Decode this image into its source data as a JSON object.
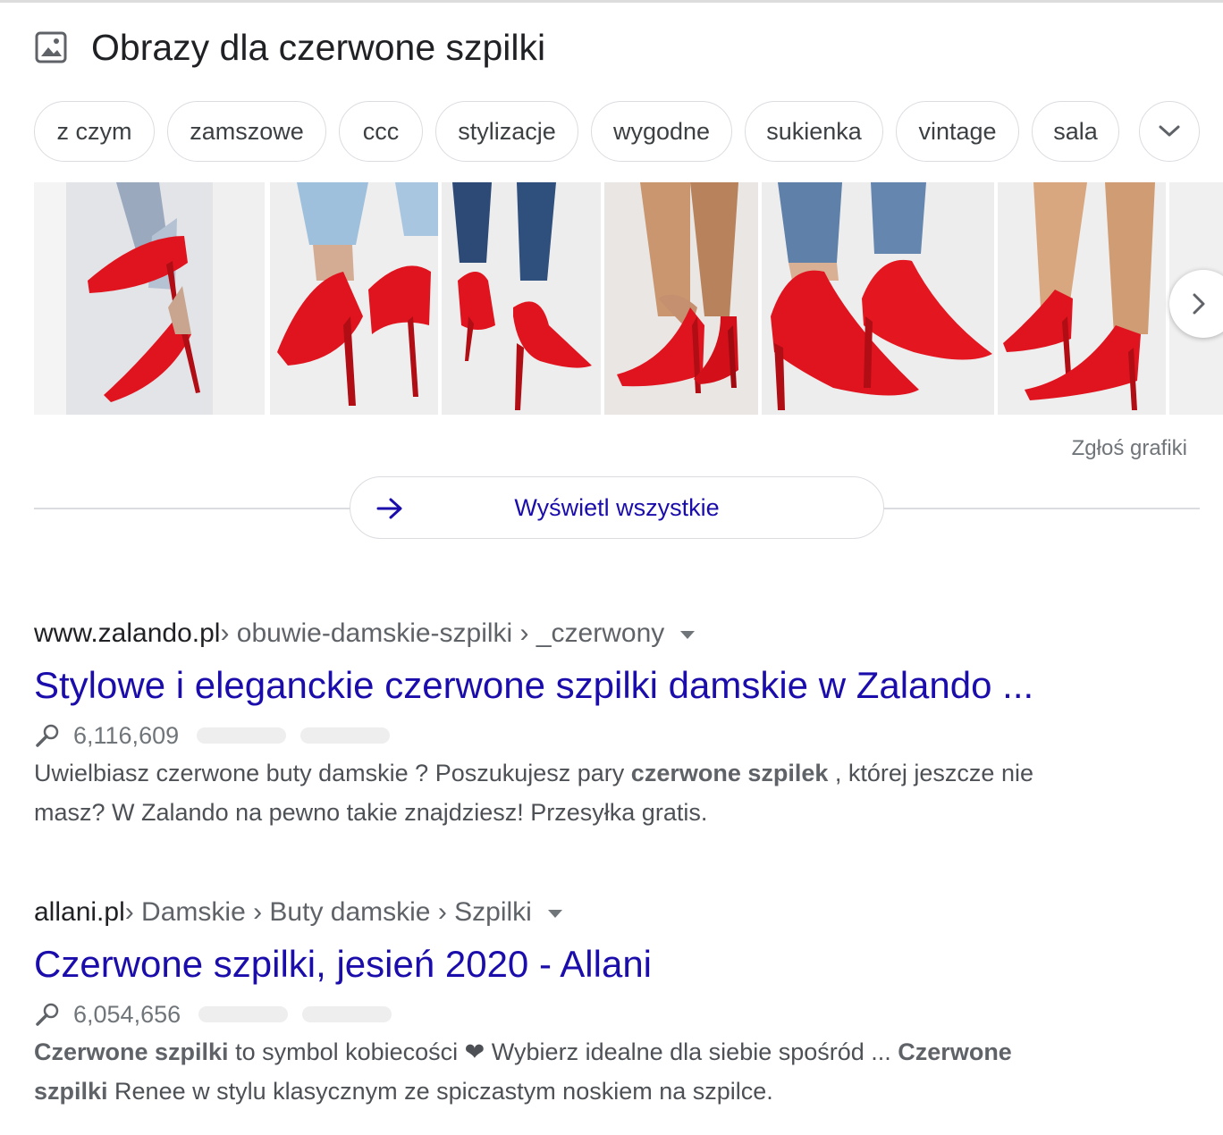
{
  "images_section": {
    "title": "Obrazy dla czerwone szpilki",
    "icon": "image-icon",
    "chips": [
      "z czym",
      "zamszowe",
      "ccc",
      "stylizacje",
      "wygodne",
      "sukienka",
      "vintage",
      "sala"
    ],
    "report_label": "Zgłoś grafiki",
    "view_all_label": "Wyświetl wszystkie"
  },
  "results": [
    {
      "domain": "www.zalando.pl",
      "path": " › obuwie-damskie-szpilki › _czerwony",
      "title": "Stylowe i eleganckie czerwone szpilki damskie w Zalando ...",
      "count": "6,116,609",
      "snippet_1a": "Uwielbiasz czerwone buty damskie ? Poszukujesz pary ",
      "snippet_1b": "czerwone szpilek",
      "snippet_1c": " , której jeszcze nie",
      "snippet_2": "masz? W Zalando na pewno takie znajdziesz! Przesyłka gratis."
    },
    {
      "domain": "allani.pl",
      "path": " › Damskie › Buty damskie › Szpilki",
      "title": "Czerwone szpilki, jesień 2020 - Allani",
      "count": "6,054,656",
      "snippet_1a": "Czerwone szpilki",
      "snippet_1b": " to symbol kobiecości ❤ Wybierz idealne dla siebie spośród ... ",
      "snippet_1c": "Czerwone",
      "snippet_2a": "szpilki",
      "snippet_2b": " Renee w stylu klasycznym ze spiczastym noskiem na szpilce."
    }
  ],
  "colors": {
    "link": "#1a0dab",
    "text": "#202124",
    "muted": "#70757a",
    "shoe_red": "#e0141e"
  }
}
